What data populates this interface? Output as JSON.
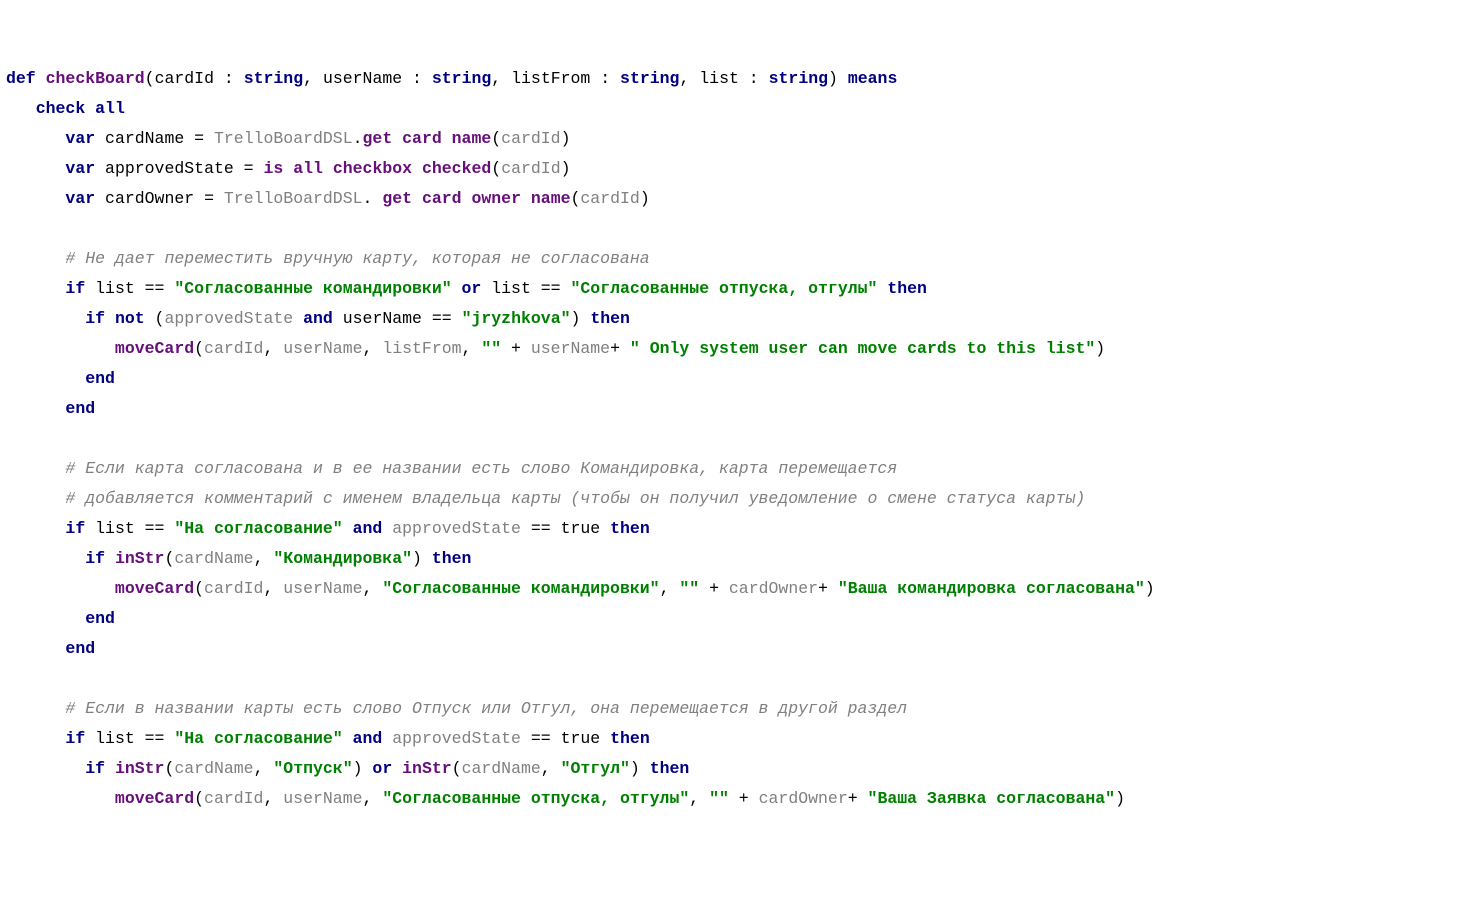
{
  "code": {
    "l1": {
      "def": "def",
      "name": "checkBoard",
      "p1": "cardId",
      "p2": "userName",
      "p3": "listFrom",
      "p4": "list",
      "colon": " : ",
      "string": "string",
      "means": "means"
    },
    "l2": {
      "check": "check",
      "all": "all"
    },
    "l3": {
      "var": "var",
      "n": "cardName",
      "eq": " = ",
      "cls": "TrelloBoardDSL",
      "dot": ".",
      "m1": "get",
      "m2": "card",
      "m3": "name",
      "arg": "cardId"
    },
    "l4": {
      "var": "var",
      "n": "approvedState",
      "eq": " = ",
      "m1": "is",
      "m2": "all",
      "m3": "checkbox",
      "m4": "checked",
      "arg": "cardId"
    },
    "l5": {
      "var": "var",
      "n": "cardOwner",
      "eq": " = ",
      "cls": "TrelloBoardDSL",
      "dot": ". ",
      "m1": "get",
      "m2": "card",
      "m3": "owner",
      "m4": "name",
      "arg": "cardId"
    },
    "c1": "# Не дает переместить вручную карту, которая не согласована",
    "l7": {
      "if": "if",
      "var": "list",
      "eq": "==",
      "s1": "\"Согласованные командировки\"",
      "or": "or",
      "s2": "\"Согласованные отпуска, отгулы\"",
      "then": "then"
    },
    "l8": {
      "if": "if",
      "not": "not",
      "v1": "approvedState",
      "and": "and",
      "v2": "userName",
      "eq": "==",
      "s": "\"jryzhkova\"",
      "then": "then"
    },
    "l9": {
      "fn": "moveCard",
      "a1": "cardId",
      "a2": "userName",
      "a3": "listFrom",
      "s1": "\"\"",
      "plus": " + ",
      "a4": "userName",
      "plus2": "+ ",
      "s2": "\" Only system user can move cards to this list\""
    },
    "end": "end",
    "c2": "# Если карта согласована и в ее названии есть слово Командировка, карта перемещается",
    "c3": "# добавляется комментарий с именем владельца карты (чтобы он получил уведомление о смене статуса карты)",
    "l14": {
      "if": "if",
      "var": "list",
      "eq": "==",
      "s": "\"На согласование\"",
      "and": "and",
      "v2": "approvedState",
      "eq2": "==",
      "true": "true",
      "then": "then"
    },
    "l15": {
      "if": "if",
      "fn": "inStr",
      "a1": "cardName",
      "s": "\"Командировка\"",
      "then": "then"
    },
    "l16": {
      "fn": "moveCard",
      "a1": "cardId",
      "a2": "userName",
      "s1": "\"Согласованные командировки\"",
      "s2": "\"\"",
      "plus": " + ",
      "a3": "cardOwner",
      "plus2": "+ ",
      "s3": "\"Ваша командировка согласована\""
    },
    "c4": "# Если в названии карты есть слово Отпуск или Отгул, она перемещается в другой раздел",
    "l20": {
      "if": "if",
      "var": "list",
      "eq": "==",
      "s": "\"На согласование\"",
      "and": "and",
      "v2": "approvedState",
      "eq2": "==",
      "true": "true",
      "then": "then"
    },
    "l21": {
      "if": "if",
      "fn": "inStr",
      "a1": "cardName",
      "s1": "\"Отпуск\"",
      "or": "or",
      "s2": "\"Отгул\"",
      "then": "then"
    },
    "l22": {
      "fn": "moveCard",
      "a1": "cardId",
      "a2": "userName",
      "s1": "\"Согласованные отпуска, отгулы\"",
      "s2": "\"\"",
      "plus": " + ",
      "a3": "cardOwner",
      "plus2": "+ ",
      "s3": "\"Ваша Заявка согласована\""
    }
  }
}
